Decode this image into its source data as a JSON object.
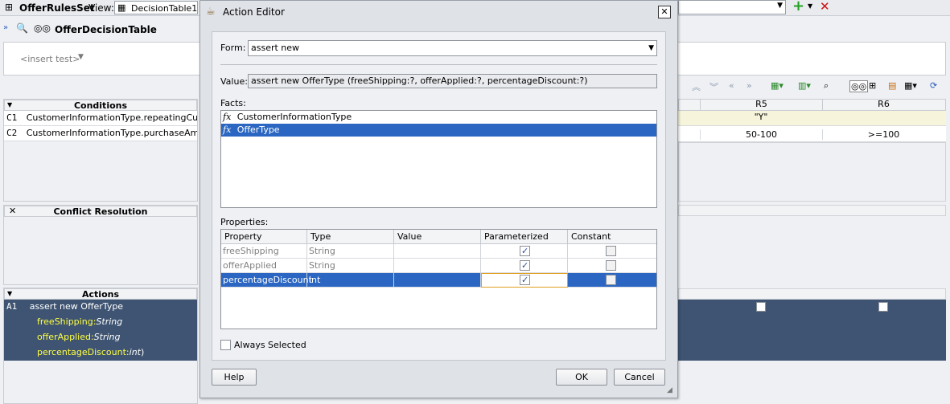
{
  "topbar": {
    "ruleset": "OfferRulesSet",
    "view_label": "View:",
    "view_value": "DecisionTable1"
  },
  "toolbar": {
    "table_name": "OfferDecisionTable"
  },
  "insert_test": "<insert test>",
  "conditions": {
    "header": "Conditions",
    "rows": [
      {
        "id": "C1",
        "text": "CustomerInformationType.repeatingCustom"
      },
      {
        "id": "C2",
        "text": "CustomerInformationType.purchaseAmount"
      }
    ]
  },
  "conflict": {
    "header": "Conflict Resolution"
  },
  "actions": {
    "header": "Actions",
    "a1_id": "A1",
    "a1_text": "assert new OfferType",
    "params": [
      {
        "name": "freeShipping",
        "type": "String",
        "suffix": ""
      },
      {
        "name": "offerApplied",
        "type": "String",
        "suffix": ""
      },
      {
        "name": "percentageDiscount",
        "type": "int",
        "suffix": ")"
      }
    ]
  },
  "rules": {
    "columns": [
      "R5",
      "R6"
    ],
    "c1_values": [
      "\"Y\"",
      ""
    ],
    "c2_values": [
      "50-100",
      ">=100"
    ]
  },
  "dialog": {
    "title": "Action Editor",
    "form_label": "Form:",
    "form_value": "assert new",
    "value_label": "Value:",
    "value_text": "assert new OfferType (freeShipping:?, offerApplied:?, percentageDiscount:?)",
    "facts_label": "Facts:",
    "facts": [
      "CustomerInformationType",
      "OfferType"
    ],
    "selected_fact": "OfferType",
    "properties_label": "Properties:",
    "prop_headers": [
      "Property",
      "Type",
      "Value",
      "Parameterized",
      "Constant"
    ],
    "props": [
      {
        "name": "freeShipping",
        "type": "String",
        "value": "",
        "parameterized": true,
        "constant": false
      },
      {
        "name": "offerApplied",
        "type": "String",
        "value": "",
        "parameterized": true,
        "constant": false
      },
      {
        "name": "percentageDiscount",
        "type": "int",
        "value": "",
        "parameterized": true,
        "constant": false
      }
    ],
    "always_selected": "Always Selected",
    "help": "Help",
    "ok": "OK",
    "cancel": "Cancel"
  },
  "colors": {
    "selection": "#2b67c2",
    "action_row": "#3e5472",
    "param_text": "#ffff44",
    "condition_row": "#f6f5dc"
  }
}
